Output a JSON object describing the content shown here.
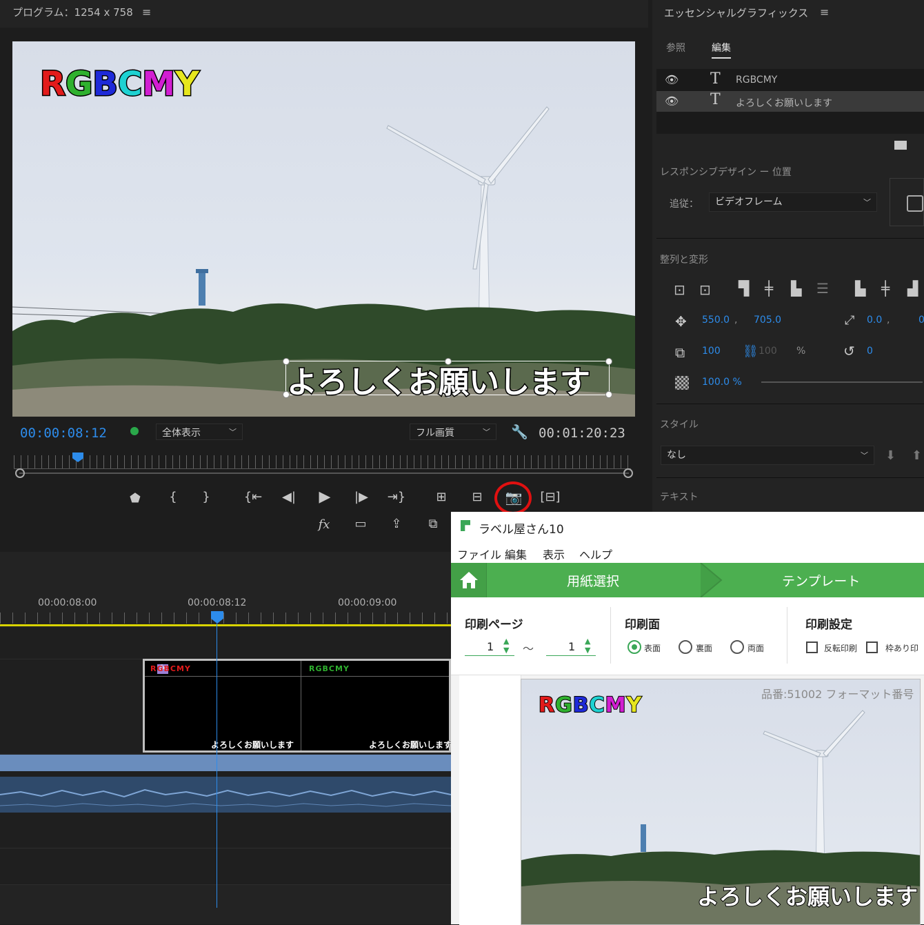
{
  "program": {
    "title": "プログラム：1254 x 758",
    "menu_icon": "hamburger-icon",
    "overlay_title": "RGBCMY",
    "overlay_title_letters": [
      {
        "ch": "R",
        "color": "#e21b1b"
      },
      {
        "ch": "G",
        "color": "#2fb12f"
      },
      {
        "ch": "B",
        "color": "#1e2ad8"
      },
      {
        "ch": "C",
        "color": "#1ed2d2"
      },
      {
        "ch": "M",
        "color": "#d21ed2"
      },
      {
        "ch": "Y",
        "color": "#e6e61e"
      }
    ],
    "subtitle": "よろしくお願いします",
    "timecode_current": "00:00:08:12",
    "timecode_total": "00:01:20:23",
    "zoom_select": "全体表示",
    "quality_select": "フル画質"
  },
  "essential_graphics": {
    "title": "エッセンシャルグラフィックス",
    "tabs": [
      "参照",
      "編集"
    ],
    "active_tab": "編集",
    "layers": [
      "RGBCMY",
      "よろしくお願いします"
    ],
    "responsive_label": "レスポンシブデザイン ー 位置",
    "follow_label": "追従：",
    "follow_value": "ビデオフレーム",
    "align_label": "整列と変形",
    "position_x": "550.0",
    "position_x_sep": ",",
    "position_y": "705.0",
    "anchor_x": "0.0",
    "anchor_sep": ",",
    "anchor_y_partial": "0",
    "scale": "100",
    "scale_linked": "100",
    "scale_unit": "%",
    "rotation": "0",
    "opacity": "100.0 %",
    "style_label": "スタイル",
    "style_value": "なし",
    "text_label": "テキスト"
  },
  "timeline": {
    "ruler": [
      "00:00:08:00",
      "00:00:08:12",
      "00:00:09:00"
    ],
    "clip_labels": [
      "RGBCMY",
      "RGBCMY"
    ],
    "clip_subtitles": [
      "よろしくお願いします",
      "よろしくお願いします"
    ],
    "fx_badge": "fx"
  },
  "label_app": {
    "title": "ラベル屋さん10",
    "menu": [
      "ファイル",
      "編集",
      "表示",
      "ヘルプ"
    ],
    "steps": [
      "用紙選択",
      "テンプレート"
    ],
    "print_page_label": "印刷ページ",
    "page_from": "1",
    "page_tilde": "～",
    "page_to": "1",
    "print_side_label": "印刷面",
    "sides": [
      "表面",
      "裏面",
      "両面"
    ],
    "selected_side": "表面",
    "print_settings_label": "印刷設定",
    "settings": [
      "反転印刷",
      "枠あり印"
    ],
    "preview_caption": "品番:51002 フォーマット番号",
    "preview_title": "RGBCMY",
    "preview_subtitle": "よろしくお願いします"
  },
  "colors": {
    "accent_blue": "#2d8ceb",
    "label_green": "#4caf50",
    "highlight_red": "#e01010",
    "playhead_yellow": "#d9d400"
  }
}
